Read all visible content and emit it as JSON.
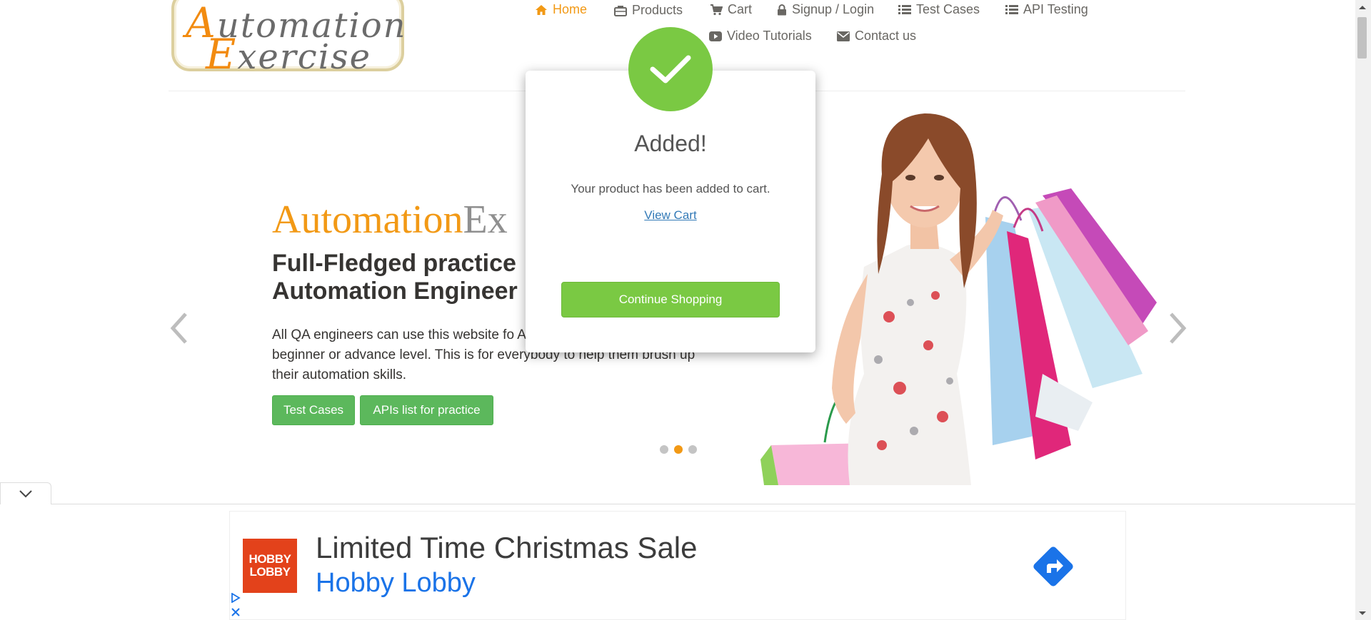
{
  "logo": {
    "line1_cap": "A",
    "line1_rest": "utomation",
    "line2_cap": "E",
    "line2_rest": "xercise"
  },
  "nav": {
    "home": "Home",
    "products": "Products",
    "cart": "Cart",
    "signup": "Signup / Login",
    "test_cases": "Test Cases",
    "api_testing": "API Testing",
    "video_tutorials": "Video Tutorials",
    "contact": "Contact us"
  },
  "slider": {
    "brand_part1": "Automation",
    "brand_part2": "Ex",
    "tagline": "Full-Fledged practice Automation Engineer",
    "description": "All QA engineers can use this website fo API testing either they are at beginner or advance level. This is for everybody to help them brush up their automation skills.",
    "btn_test_cases": "Test Cases",
    "btn_apis": "APIs list for practice",
    "active_slide": 2,
    "slide_count": 3
  },
  "modal": {
    "title": "Added!",
    "message": "Your product has been added to cart.",
    "view_cart": "View Cart",
    "continue": "Continue Shopping"
  },
  "ad": {
    "logo_line1": "HOBBY",
    "logo_line2": "LOBBY",
    "headline": "Limited Time Christmas Sale",
    "brand": "Hobby Lobby"
  },
  "colors": {
    "accent": "#f29915",
    "success": "#7ac943",
    "button_green": "#5cb85c",
    "link": "#337ab7",
    "ad_brand": "#1a73e8"
  }
}
